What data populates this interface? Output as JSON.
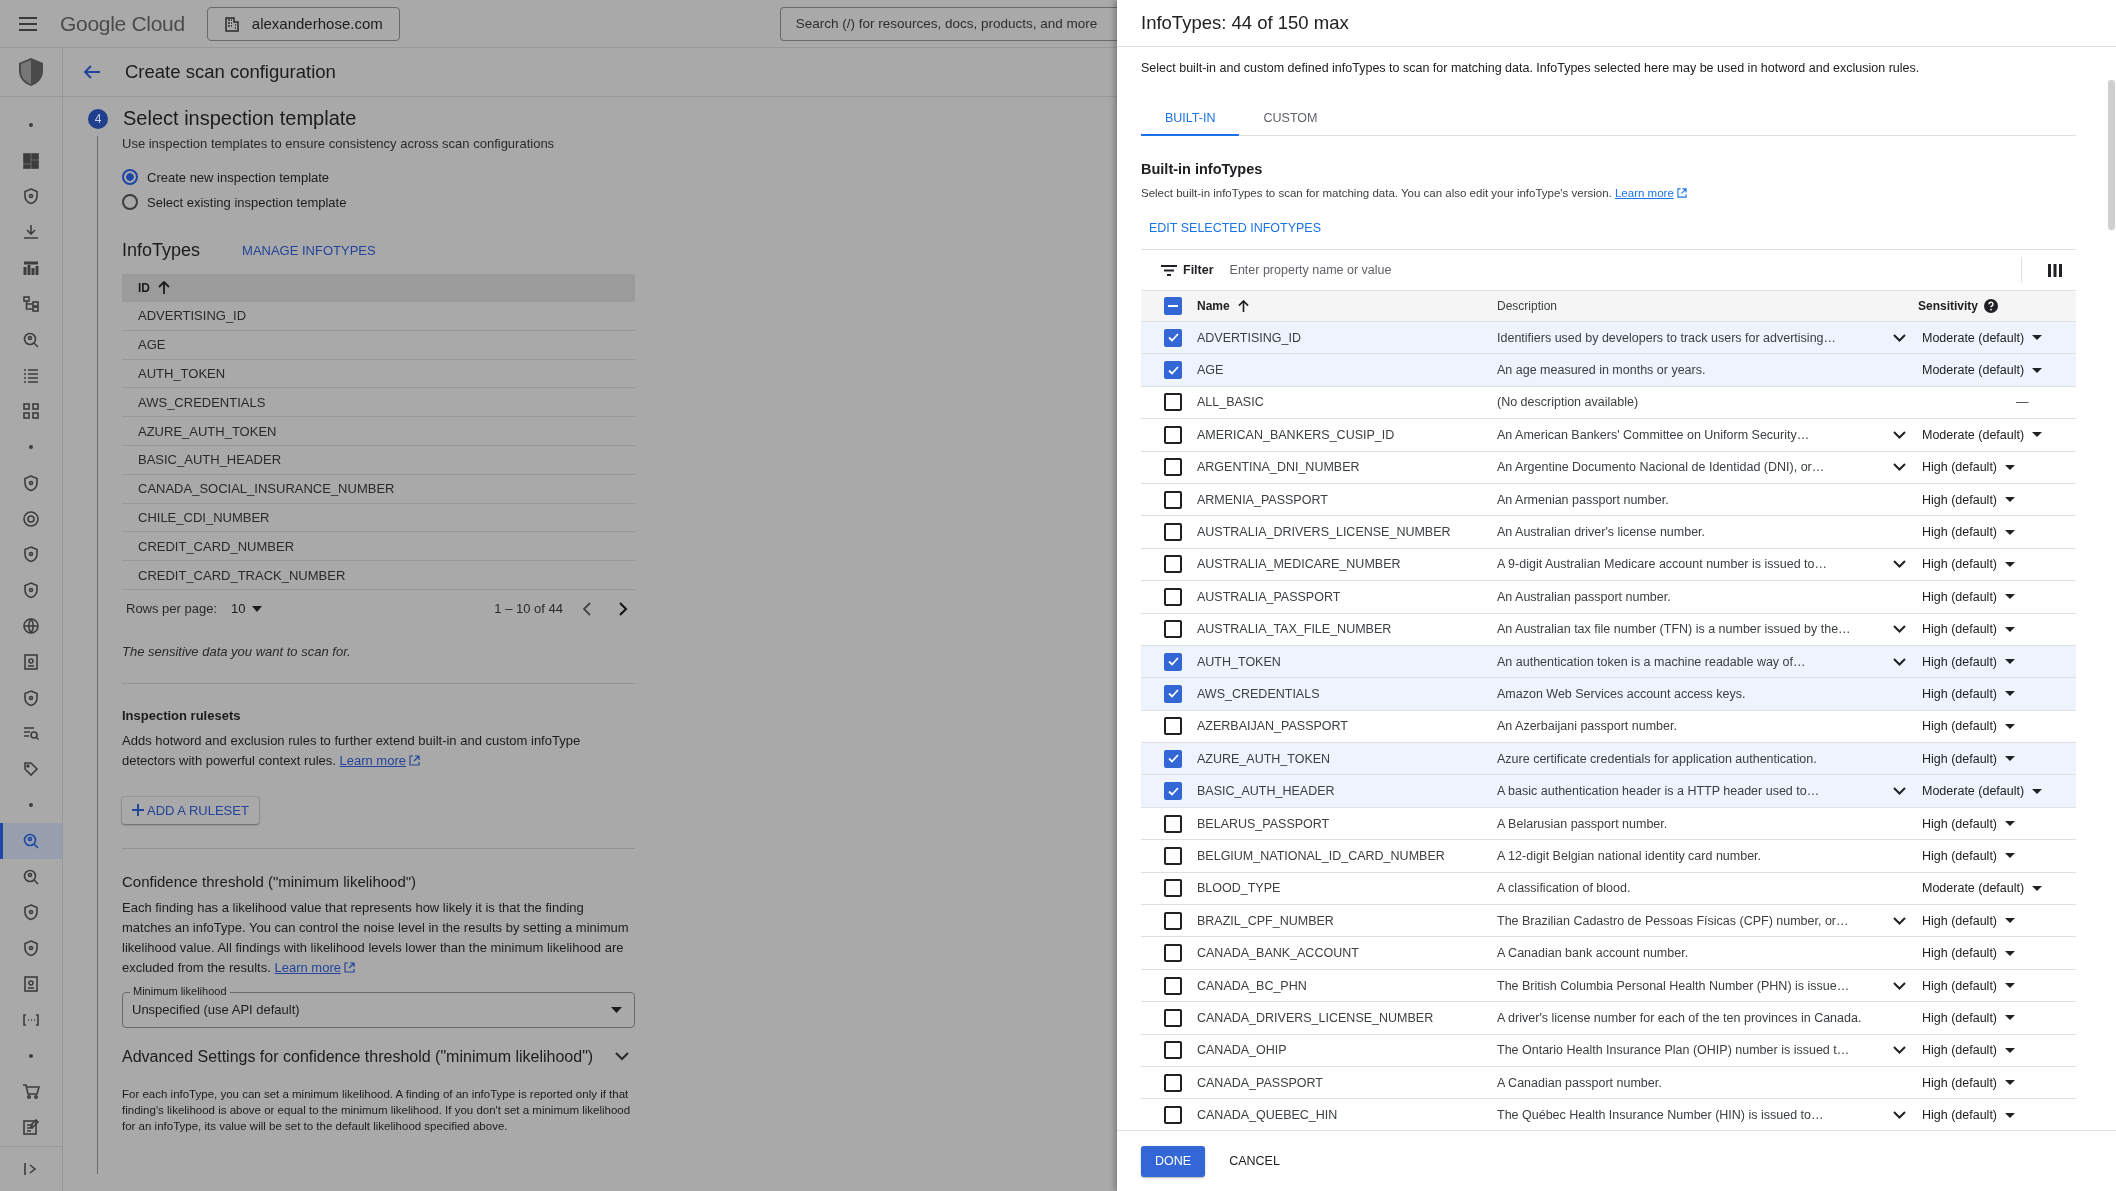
{
  "top_bar": {
    "product": "Google Cloud",
    "organization": "alexanderhose.com",
    "search": {
      "placeholder": "Search (/) for resources, docs, products, and more"
    }
  },
  "nav_rail": [
    {
      "selected": false
    },
    {
      "selected": false
    },
    {
      "selected": false
    },
    {
      "selected": false
    },
    {
      "selected": false
    },
    {
      "selected": false
    },
    {
      "selected": false
    },
    {
      "selected": false
    },
    {
      "selected": false
    },
    {
      "selected": false
    },
    {
      "selected": false
    },
    {
      "selected": false
    },
    {
      "selected": false
    },
    {
      "selected": false
    },
    {
      "selected": false
    },
    {
      "selected": false
    },
    {
      "selected": false
    },
    {
      "selected": true
    },
    {
      "selected": false
    },
    {
      "selected": false
    },
    {
      "selected": false
    },
    {
      "selected": false
    },
    {
      "selected": false
    },
    {
      "selected": false
    },
    {
      "selected": false
    }
  ],
  "page": {
    "title": "Create scan configuration",
    "step": {
      "number": "4",
      "title": "Select inspection template",
      "subtitle": "Use inspection templates to ensure consistency across scan configurations"
    },
    "template_options": [
      {
        "label": "Create new inspection template",
        "selected": true
      },
      {
        "label": "Select existing inspection template",
        "selected": false
      }
    ],
    "infotypes": {
      "title": "InfoTypes",
      "action": "MANAGE INFOTYPES",
      "column": "ID",
      "rows": [
        "ADVERTISING_ID",
        "AGE",
        "AUTH_TOKEN",
        "AWS_CREDENTIALS",
        "AZURE_AUTH_TOKEN",
        "BASIC_AUTH_HEADER",
        "CANADA_SOCIAL_INSURANCE_NUMBER",
        "CHILE_CDI_NUMBER",
        "CREDIT_CARD_NUMBER",
        "CREDIT_CARD_TRACK_NUMBER"
      ],
      "rows_per_page_label": "Rows per page:",
      "rows_per_page": "10",
      "range": "1 – 10 of 44",
      "caption": "The sensitive data you want to scan for."
    },
    "rulesets": {
      "title": "Inspection rulesets",
      "text": "Adds hotword and exclusion rules to further extend built-in and custom infoType detectors with powerful context rules.",
      "link": "Learn more",
      "button": "ADD A RULESET"
    },
    "confidence": {
      "title": "Confidence threshold (\"minimum likelihood\")",
      "text": "Each finding has a likelihood value that represents how likely it is that the finding matches an infoType. You can control the noise level in the results by setting a minimum likelihood value. All findings with likelihood levels lower than the minimum likelihood are excluded from the results.",
      "link": "Learn more",
      "select_label": "Minimum likelihood",
      "select_value": "Unspecified (use API default)"
    },
    "advanced": {
      "title": "Advanced Settings for confidence threshold (\"minimum likelihood\")",
      "text": "For each infoType, you can set a minimum likelihood. A finding of an infoType is reported only if that finding's likelihood is above or equal to the minimum likelihood. If you don't set a minimum likelihood for an infoType, its value will be set to the default likelihood specified above."
    }
  },
  "panel": {
    "title": "InfoTypes: 44 of 150 max",
    "description": "Select built-in and custom defined infoTypes to scan for matching data. InfoTypes selected here may be used in hotword and exclusion rules.",
    "tabs": [
      {
        "label": "BUILT-IN",
        "selected": true
      },
      {
        "label": "CUSTOM",
        "selected": false
      }
    ],
    "section_title": "Built-in infoTypes",
    "section_text": "Select built-in infoTypes to scan for matching data. You can also edit your infoType's version.",
    "section_link": "Learn more",
    "edit_button": "EDIT SELECTED INFOTYPES",
    "filter": {
      "label": "Filter",
      "placeholder": "Enter property name or value"
    },
    "columns": {
      "name": "Name",
      "description": "Description",
      "sensitivity": "Sensitivity"
    },
    "select_all": {
      "indeterminate": true
    },
    "rows": [
      {
        "name": "ADVERTISING_ID",
        "description": "Identifiers used by developers to track users for advertising…",
        "expandable": true,
        "sensitivity": "Moderate (default)",
        "editable": true,
        "checked": true
      },
      {
        "name": "AGE",
        "description": "An age measured in months or years.",
        "expandable": false,
        "sensitivity": "Moderate (default)",
        "editable": true,
        "checked": true
      },
      {
        "name": "ALL_BASIC",
        "description": "(No description available)",
        "expandable": false,
        "sensitivity": "—",
        "editable": false,
        "checked": false
      },
      {
        "name": "AMERICAN_BANKERS_CUSIP_ID",
        "description": "An American Bankers' Committee on Uniform Security…",
        "expandable": true,
        "sensitivity": "Moderate (default)",
        "editable": true,
        "checked": false
      },
      {
        "name": "ARGENTINA_DNI_NUMBER",
        "description": "An Argentine Documento Nacional de Identidad (DNI), or…",
        "expandable": true,
        "sensitivity": "High (default)",
        "editable": true,
        "checked": false
      },
      {
        "name": "ARMENIA_PASSPORT",
        "description": "An Armenian passport number.",
        "expandable": false,
        "sensitivity": "High (default)",
        "editable": true,
        "checked": false
      },
      {
        "name": "AUSTRALIA_DRIVERS_LICENSE_NUMBER",
        "description": "An Australian driver's license number.",
        "expandable": false,
        "sensitivity": "High (default)",
        "editable": true,
        "checked": false
      },
      {
        "name": "AUSTRALIA_MEDICARE_NUMBER",
        "description": "A 9-digit Australian Medicare account number is issued to…",
        "expandable": true,
        "sensitivity": "High (default)",
        "editable": true,
        "checked": false
      },
      {
        "name": "AUSTRALIA_PASSPORT",
        "description": "An Australian passport number.",
        "expandable": false,
        "sensitivity": "High (default)",
        "editable": true,
        "checked": false
      },
      {
        "name": "AUSTRALIA_TAX_FILE_NUMBER",
        "description": "An Australian tax file number (TFN) is a number issued by the…",
        "expandable": true,
        "sensitivity": "High (default)",
        "editable": true,
        "checked": false
      },
      {
        "name": "AUTH_TOKEN",
        "description": "An authentication token is a machine readable way of…",
        "expandable": true,
        "sensitivity": "High (default)",
        "editable": true,
        "checked": true
      },
      {
        "name": "AWS_CREDENTIALS",
        "description": "Amazon Web Services account access keys.",
        "expandable": false,
        "sensitivity": "High (default)",
        "editable": true,
        "checked": true
      },
      {
        "name": "AZERBAIJAN_PASSPORT",
        "description": "An Azerbaijani passport number.",
        "expandable": false,
        "sensitivity": "High (default)",
        "editable": true,
        "checked": false
      },
      {
        "name": "AZURE_AUTH_TOKEN",
        "description": "Azure certificate credentials for application authentication.",
        "expandable": false,
        "sensitivity": "High (default)",
        "editable": true,
        "checked": true
      },
      {
        "name": "BASIC_AUTH_HEADER",
        "description": "A basic authentication header is a HTTP header used to…",
        "expandable": true,
        "sensitivity": "Moderate (default)",
        "editable": true,
        "checked": true
      },
      {
        "name": "BELARUS_PASSPORT",
        "description": "A Belarusian passport number.",
        "expandable": false,
        "sensitivity": "High (default)",
        "editable": true,
        "checked": false
      },
      {
        "name": "BELGIUM_NATIONAL_ID_CARD_NUMBER",
        "description": "A 12-digit Belgian national identity card number.",
        "expandable": false,
        "sensitivity": "High (default)",
        "editable": true,
        "checked": false
      },
      {
        "name": "BLOOD_TYPE",
        "description": "A classification of blood.",
        "expandable": false,
        "sensitivity": "Moderate (default)",
        "editable": true,
        "checked": false
      },
      {
        "name": "BRAZIL_CPF_NUMBER",
        "description": "The Brazilian Cadastro de Pessoas Físicas (CPF) number, or…",
        "expandable": true,
        "sensitivity": "High (default)",
        "editable": true,
        "checked": false
      },
      {
        "name": "CANADA_BANK_ACCOUNT",
        "description": "A Canadian bank account number.",
        "expandable": false,
        "sensitivity": "High (default)",
        "editable": true,
        "checked": false
      },
      {
        "name": "CANADA_BC_PHN",
        "description": "The British Columbia Personal Health Number (PHN) is issue…",
        "expandable": true,
        "sensitivity": "High (default)",
        "editable": true,
        "checked": false
      },
      {
        "name": "CANADA_DRIVERS_LICENSE_NUMBER",
        "description": "A driver's license number for each of the ten provinces in Canada.",
        "expandable": false,
        "sensitivity": "High (default)",
        "editable": true,
        "checked": false
      },
      {
        "name": "CANADA_OHIP",
        "description": "The Ontario Health Insurance Plan (OHIP) number is issued t…",
        "expandable": true,
        "sensitivity": "High (default)",
        "editable": true,
        "checked": false
      },
      {
        "name": "CANADA_PASSPORT",
        "description": "A Canadian passport number.",
        "expandable": false,
        "sensitivity": "High (default)",
        "editable": true,
        "checked": false
      },
      {
        "name": "CANADA_QUEBEC_HIN",
        "description": "The Québec Health Insurance Number (HIN) is issued to…",
        "expandable": true,
        "sensitivity": "High (default)",
        "editable": true,
        "checked": false
      }
    ],
    "buttons": {
      "done": "DONE",
      "cancel": "CANCEL"
    }
  }
}
